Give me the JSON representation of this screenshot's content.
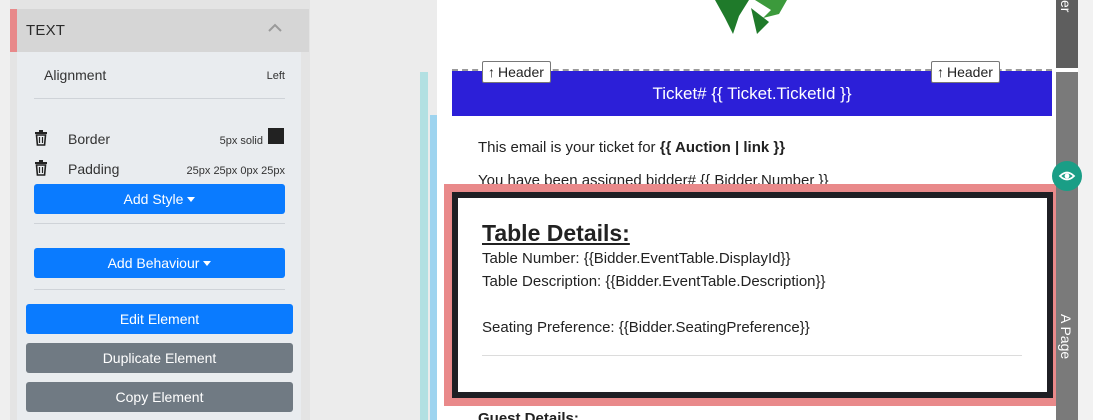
{
  "panel": {
    "section_title": "TEXT",
    "alignment": {
      "label": "Alignment",
      "value": "Left"
    },
    "styles": [
      {
        "label": "Border",
        "value": "5px solid",
        "swatch_color": "#222222"
      },
      {
        "label": "Padding",
        "value": "25px 25px 0px 25px"
      }
    ],
    "buttons": {
      "add_style": "Add Style",
      "add_behaviour": "Add Behaviour",
      "edit_element": "Edit Element",
      "duplicate_element": "Duplicate Element",
      "copy_element": "Copy Element"
    }
  },
  "canvas": {
    "header_tag_left": "Header",
    "header_tag_right": "Header",
    "banner_text": "Ticket# {{ Ticket.TicketId }}",
    "banner_color": "#2c1fd8",
    "intro_prefix": "This email is your ticket for ",
    "intro_bold": "{{ Auction | link }}",
    "bidder_line": "You have been assigned bidder# {{ Bidder.Number }}",
    "table_title": "Table Details:",
    "table_number": "Table Number: {{Bidder.EventTable.DisplayId}}",
    "table_description": "Table Description: {{Bidder.EventTable.Description}}",
    "seating_preference": "Seating Preference: {{Bidder.SeatingPreference}}",
    "guest_details": "Guest Details:",
    "selection_color": "#e9898a"
  },
  "rail": {
    "top_label": "er",
    "page_label": "A Page",
    "eye_color": "#1a9e86"
  },
  "icons": [
    "chevron-up-icon",
    "trash-icon",
    "caret-down-icon",
    "arrow-up-icon",
    "eye-icon",
    "logo-icon"
  ]
}
